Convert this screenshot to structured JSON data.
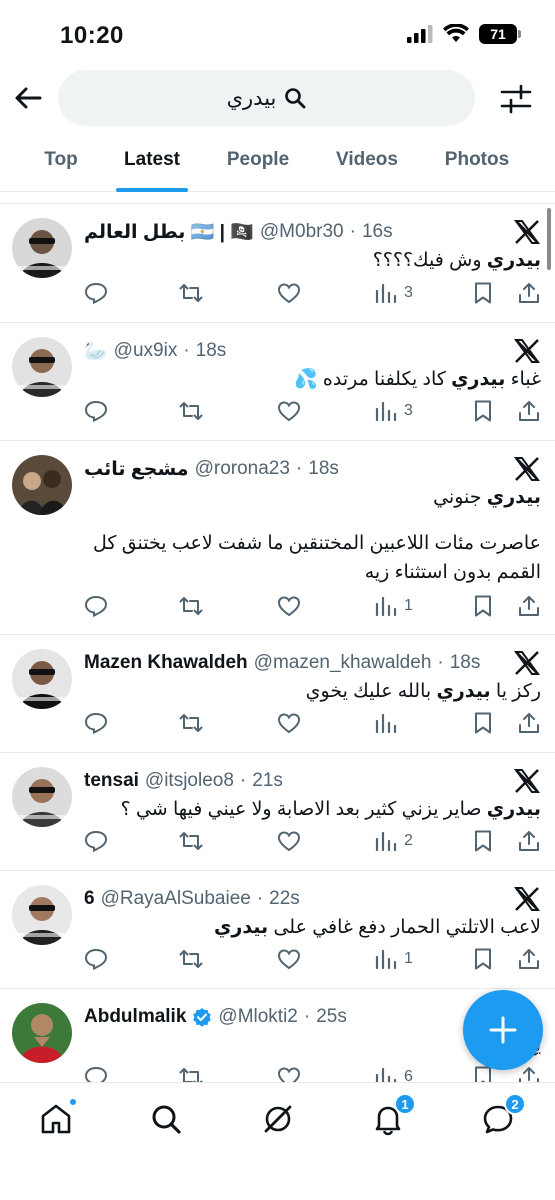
{
  "status": {
    "time": "10:20",
    "battery": "71"
  },
  "search": {
    "query": "بيدري"
  },
  "tabs": [
    {
      "label": "Top"
    },
    {
      "label": "Latest"
    },
    {
      "label": "People"
    },
    {
      "label": "Videos"
    },
    {
      "label": "Photos"
    }
  ],
  "tweets": [
    {
      "name": "بطل العالم 🇦🇷 | 🏴‍☠️",
      "handle": "@M0br30",
      "time": "16s",
      "text_bold": "بيدري",
      "text_rest": " وش فيك؟؟؟؟",
      "views": "3"
    },
    {
      "name": "🦢",
      "handle": "@ux9ix",
      "time": "18s",
      "text_pre": "غباء ",
      "text_bold": "بيدري",
      "text_rest": " كاد يكلفنا مرتده 💦",
      "views": "3"
    },
    {
      "name": "مشجع تائب",
      "handle": "@rorona23",
      "time": "18s",
      "text_bold": "بيدري",
      "text_rest": " جنوني",
      "text_para": "عاصرت مئات اللاعبين المختنقين ما شفت لاعب يختنق كل القمم بدون استثناء زيه",
      "views": "1"
    },
    {
      "name": "Mazen Khawaldeh",
      "handle": "@mazen_khawaldeh",
      "time": "18s",
      "text_pre": "ركز يا ",
      "text_bold": "بيدري",
      "text_rest": " بالله عليك يخوي",
      "views": ""
    },
    {
      "name": "tensai",
      "handle": "@itsjoleo8",
      "time": "21s",
      "text_bold": "بيدري",
      "text_rest": " صاير يزني كثير بعد الاصابة ولا عيني فيها شي ؟",
      "views": "2"
    },
    {
      "name": "6",
      "handle": "@RayaAlSubaiee",
      "time": "22s",
      "text_pre": "لاعب الاتلتي الحمار دفع غافي على ",
      "text_bold": "بيدري",
      "text_rest": "",
      "views": "1"
    },
    {
      "name": "Abdulmalik",
      "handle": "@Mlokti2",
      "time": "25s",
      "text_pre": "",
      "text_bold": "",
      "text_rest": "يع",
      "views": "6"
    }
  ],
  "nav": {
    "notifications_badge": "1",
    "messages_badge": "2"
  },
  "colors": {
    "accent": "#1d9bf0",
    "text": "#0f1419",
    "muted": "#536471"
  }
}
